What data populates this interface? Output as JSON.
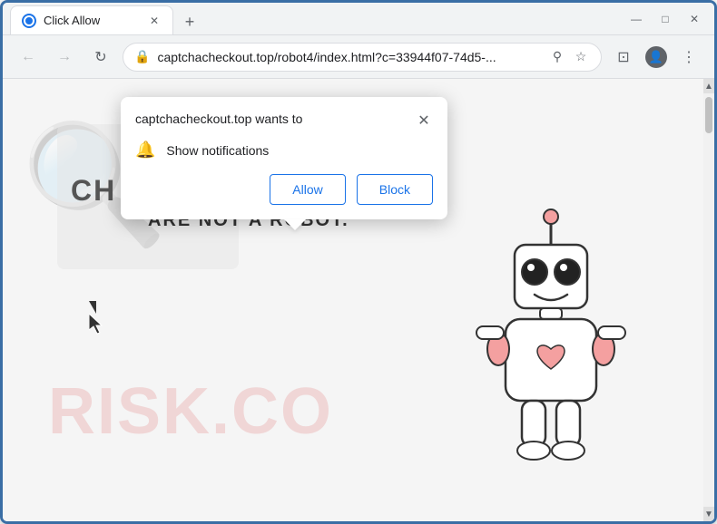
{
  "browser": {
    "tab_title": "Click Allow",
    "tab_favicon": "globe",
    "url": "captchacheckout.top/robot4/index.html?c=33944f07-74d5-...",
    "new_tab_label": "+",
    "window_controls": {
      "minimize": "—",
      "maximize": "□",
      "close": "✕"
    },
    "nav": {
      "back": "←",
      "forward": "→",
      "reload": "↻"
    },
    "toolbar_icons": {
      "search": "⚲",
      "bookmark": "☆",
      "profile": "👤",
      "menu": "⋮",
      "cast": "⊡"
    }
  },
  "page": {
    "watermark": "RISK.CO",
    "ch_text": "CH",
    "are_not_robot": "ARE NOT A ROBOT."
  },
  "popup": {
    "title": "captchacheckout.top wants to",
    "notification_text": "Show notifications",
    "close_icon": "✕",
    "bell_icon": "🔔",
    "allow_label": "Allow",
    "block_label": "Block"
  },
  "scrollbar": {
    "up_arrow": "▲",
    "down_arrow": "▼"
  }
}
